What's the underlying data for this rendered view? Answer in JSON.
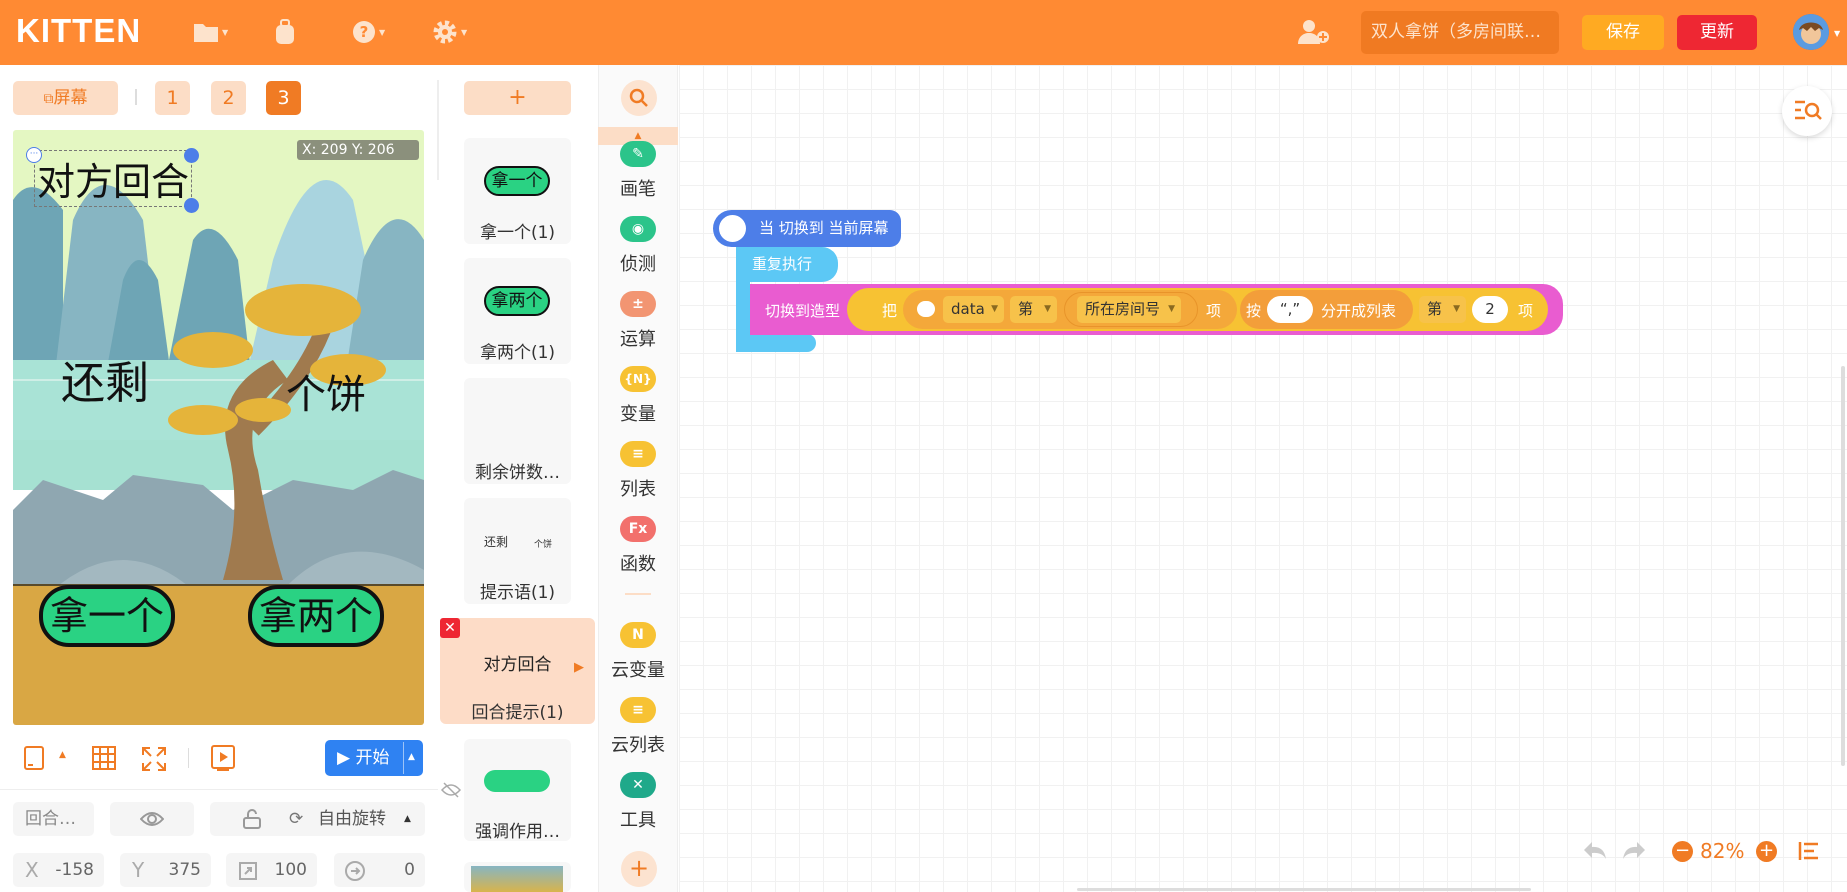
{
  "app": {
    "logo": "KITTEN",
    "project_name": "双人拿饼（多房间联…",
    "save_label": "保存",
    "update_label": "更新"
  },
  "stage_panel": {
    "screen_label": "屏幕",
    "pages": [
      "1",
      "2",
      "3"
    ],
    "active_page": "3",
    "coords": "X: 209    Y: 206",
    "stage_texts": {
      "turn": "对方回合",
      "remain": "还剩",
      "cakes": "个饼"
    },
    "stage_buttons": {
      "take_one": "拿一个",
      "take_two": "拿两个"
    },
    "start_label": "开始",
    "props": {
      "name": "回合…",
      "rotation_mode": "自由旋转",
      "x_label": "X",
      "x_value": "-158",
      "y_label": "Y",
      "y_value": "375",
      "size_value": "100",
      "angle_value": "0"
    }
  },
  "sprites": {
    "add_label": "+",
    "items": [
      {
        "name": "拿一个(1)",
        "thumb": "拿一个"
      },
      {
        "name": "拿两个(1)",
        "thumb": "拿两个"
      },
      {
        "name": "剩余饼数…",
        "thumb": ""
      },
      {
        "name": "提示语(1)",
        "thumb_left": "还剩",
        "thumb_right": "个饼"
      },
      {
        "name": "回合提示(1)",
        "thumb": "对方回合"
      },
      {
        "name": "强调作用…",
        "thumb": ""
      }
    ],
    "close_label": "✕"
  },
  "categories": [
    {
      "label": "画笔",
      "color": "#2BC48A",
      "icon": "✎"
    },
    {
      "label": "侦测",
      "color": "#2BC48A",
      "icon": "◉"
    },
    {
      "label": "运算",
      "color": "#F29572",
      "icon": "±"
    },
    {
      "label": "变量",
      "color": "#F7C233",
      "icon": "{N}"
    },
    {
      "label": "列表",
      "color": "#F7C233",
      "icon": "≡"
    },
    {
      "label": "函数",
      "color": "#F2706C",
      "icon": "Fx"
    },
    {
      "label": "云变量",
      "color": "#F7C233",
      "icon": "N"
    },
    {
      "label": "云列表",
      "color": "#F7C233",
      "icon": "≡"
    },
    {
      "label": "工具",
      "color": "#1FA98A",
      "icon": "✕"
    }
  ],
  "blocks": {
    "hat": "当 切换到 当前屏幕",
    "repeat": "重复执行",
    "switch_costume": "切换到造型",
    "ba": "把",
    "data_var": "data",
    "di1": "第",
    "room_var": "所在房间号",
    "xiang1": "项",
    "an": "按",
    "sep_value": "“,”",
    "split_label": "分开成列表",
    "di2": "第",
    "index_value": "2",
    "xiang2": "项"
  },
  "zoom": {
    "value": "82%"
  }
}
